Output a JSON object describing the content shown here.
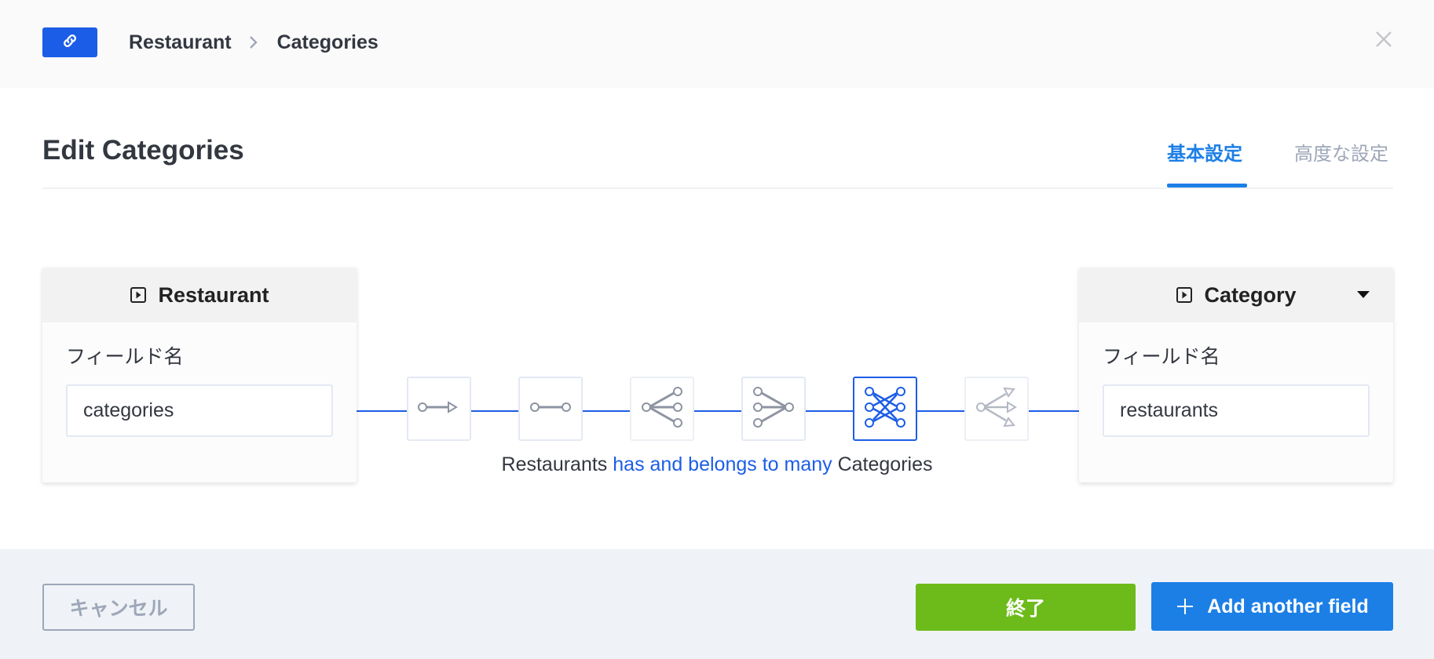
{
  "header": {
    "breadcrumb": [
      "Restaurant",
      "Categories"
    ],
    "link_icon": "link-icon",
    "close_icon": "close-icon"
  },
  "title": "Edit Categories",
  "tabs": [
    {
      "label": "基本設定",
      "active": true
    },
    {
      "label": "高度な設定",
      "active": false
    }
  ],
  "left_card": {
    "model": "Restaurant",
    "field_label": "フィールド名",
    "field_value": "categories"
  },
  "right_card": {
    "model": "Category",
    "field_label": "フィールド名",
    "field_value": "restaurants"
  },
  "relations": [
    {
      "name": "one-way",
      "icon": "one-way-icon",
      "selected": false
    },
    {
      "name": "one-to-one",
      "icon": "one-to-one-icon",
      "selected": false
    },
    {
      "name": "one-to-many",
      "icon": "one-to-many-icon",
      "selected": false
    },
    {
      "name": "many-to-one",
      "icon": "many-to-one-icon",
      "selected": false
    },
    {
      "name": "many-to-many",
      "icon": "many-to-many-icon",
      "selected": true
    },
    {
      "name": "many-way",
      "icon": "many-way-icon",
      "selected": false
    }
  ],
  "relation_description": {
    "subject": "Restaurants",
    "verb": "has and belongs to many",
    "object": "Categories"
  },
  "footer": {
    "cancel_label": "キャンセル",
    "finish_label": "終了",
    "add_label": "Add another field"
  },
  "colors": {
    "accent": "#1c5de7",
    "tab_active": "#1c7fe6",
    "finish": "#6dbb1a",
    "add": "#1c7fe6"
  }
}
